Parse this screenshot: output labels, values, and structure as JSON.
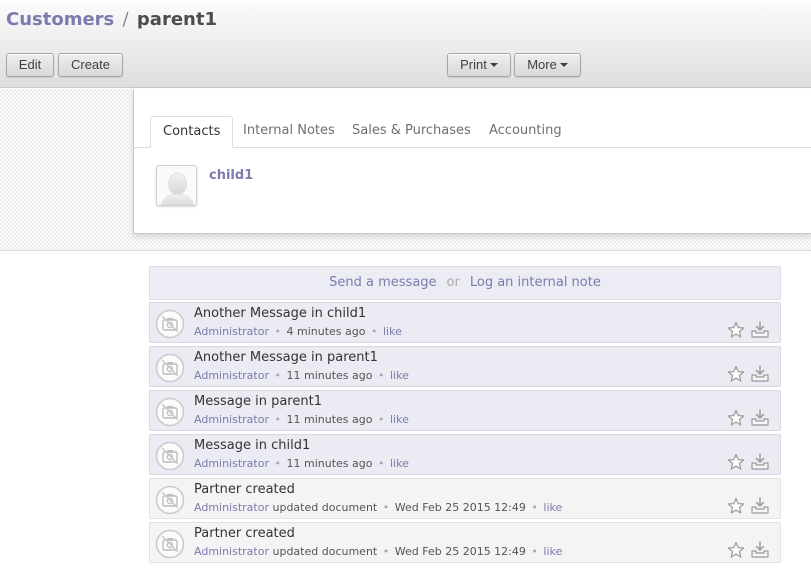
{
  "breadcrumb": {
    "parent": "Customers",
    "separator": "/",
    "current": "parent1"
  },
  "toolbar": {
    "edit_label": "Edit",
    "create_label": "Create",
    "print_label": "Print",
    "more_label": "More"
  },
  "tabs": [
    {
      "label": "Contacts",
      "active": true
    },
    {
      "label": "Internal Notes",
      "active": false
    },
    {
      "label": "Sales & Purchases",
      "active": false
    },
    {
      "label": "Accounting",
      "active": false
    }
  ],
  "contacts": [
    {
      "name": "child1",
      "avatar_icon": "person-placeholder-icon"
    }
  ],
  "composer": {
    "send_message": "Send a message",
    "or": "or",
    "log_note": "Log an internal note"
  },
  "messages": [
    {
      "title": "Another Message in child1",
      "author": "Administrator",
      "action": "",
      "time": "4 minutes ago",
      "like": "like",
      "unread": true
    },
    {
      "title": "Another Message in parent1",
      "author": "Administrator",
      "action": "",
      "time": "11 minutes ago",
      "like": "like",
      "unread": true
    },
    {
      "title": "Message in parent1",
      "author": "Administrator",
      "action": "",
      "time": "11 minutes ago",
      "like": "like",
      "unread": true
    },
    {
      "title": "Message in child1",
      "author": "Administrator",
      "action": "",
      "time": "11 minutes ago",
      "like": "like",
      "unread": true
    },
    {
      "title": "Partner created",
      "author": "Administrator",
      "action": "updated document",
      "time": "Wed Feb 25 2015 12:49",
      "like": "like",
      "unread": false
    },
    {
      "title": "Partner created",
      "author": "Administrator",
      "action": "updated document",
      "time": "Wed Feb 25 2015 12:49",
      "like": "like",
      "unread": false
    }
  ],
  "colors": {
    "link": "#7c7bad",
    "unread_bg": "#ebebf3",
    "read_bg": "#f4f4f4"
  },
  "icons": {
    "message_avatar": "no-camera-icon",
    "star": "star-icon",
    "archive": "archive-icon"
  }
}
